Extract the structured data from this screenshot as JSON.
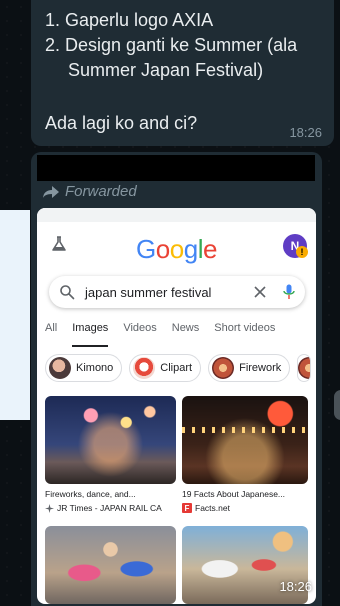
{
  "message1": {
    "list_line1": "1. Gaperlu logo AXIA",
    "list_line2a": "2. Design ganti ke Summer (ala",
    "list_line2b": "Summer Japan Festival)",
    "question": "Ada lagi ko and ci?",
    "time": "18:26"
  },
  "message2": {
    "forwarded_label": "Forwarded",
    "time": "18:26",
    "screenshot": {
      "logo": "Google",
      "avatar_initial": "N",
      "search_query": "japan summer festival",
      "tabs": [
        "All",
        "Images",
        "Videos",
        "News",
        "Short videos"
      ],
      "active_tab": "Images",
      "chips": [
        "Kimono",
        "Clipart",
        "Firework"
      ],
      "results": [
        {
          "caption": "Fireworks, dance, and...",
          "source": "JR Times - JAPAN RAIL CA"
        },
        {
          "caption": "19 Facts About Japanese...",
          "source": "Facts.net"
        }
      ]
    }
  },
  "colors": {
    "chat_bg": "#0b1014",
    "bubble": "#1f2c34",
    "meta_text": "#8696a0",
    "google_blue": "#4285f4",
    "google_red": "#ea4335",
    "google_yellow": "#fbbc05",
    "google_green": "#34a853"
  }
}
